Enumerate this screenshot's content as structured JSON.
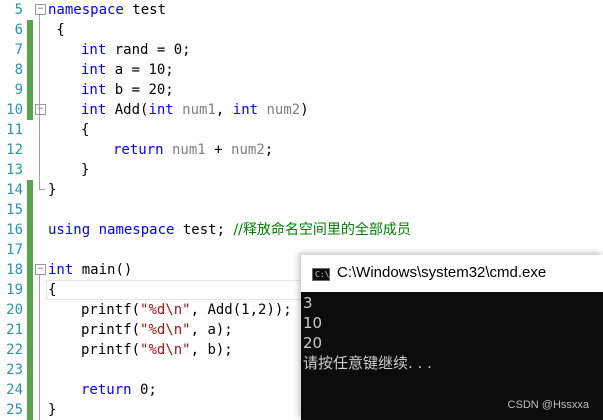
{
  "editor": {
    "lines": [
      {
        "n": "5"
      },
      {
        "n": "6"
      },
      {
        "n": "7"
      },
      {
        "n": "8"
      },
      {
        "n": "9"
      },
      {
        "n": "10"
      },
      {
        "n": "11"
      },
      {
        "n": "12"
      },
      {
        "n": "13"
      },
      {
        "n": "14"
      },
      {
        "n": "15"
      },
      {
        "n": "16"
      },
      {
        "n": "17"
      },
      {
        "n": "18"
      },
      {
        "n": "19"
      },
      {
        "n": "20"
      },
      {
        "n": "21"
      },
      {
        "n": "22"
      },
      {
        "n": "23"
      },
      {
        "n": "24"
      },
      {
        "n": "25"
      }
    ],
    "code": {
      "l5_kw": "namespace",
      "l5_name": " test",
      "l6": " {",
      "l7_kw": "int",
      "l7_rest": " rand = 0;",
      "l8_kw": "int",
      "l8_rest": " a = 10;",
      "l9_kw": "int",
      "l9_rest": " b = 20;",
      "l10_kw1": "int",
      "l10_a": " Add(",
      "l10_kw2": "int",
      "l10_p1": " num1",
      "l10_b": ", ",
      "l10_kw3": "int",
      "l10_p2": " num2",
      "l10_c": ")",
      "l11": "{",
      "l12_kw": "return",
      "l12_p1": " num1",
      "l12_a": " + ",
      "l12_p2": "num2",
      "l12_b": ";",
      "l13": "}",
      "l14": "}",
      "l16_kw1": "using",
      "l16_sp": " ",
      "l16_kw2": "namespace",
      "l16_rest": " test; ",
      "l16_comment": "//释放命名空间里的全部成员",
      "l18_kw": "int",
      "l18_rest": " main()",
      "l19": "{",
      "l20_a": "printf(",
      "l20_str": "\"%d\\n\"",
      "l20_b": ", Add(1,2));",
      "l21_a": "printf(",
      "l21_str": "\"%d\\n\"",
      "l21_b": ", a);",
      "l22_a": "printf(",
      "l22_str": "\"%d\\n\"",
      "l22_b": ", b);",
      "l24_kw": "return",
      "l24_rest": " 0;",
      "l25": "}"
    },
    "colors": {
      "keyword": "#0000ff",
      "param": "#808080",
      "string": "#a31515",
      "comment": "#008000",
      "line_number": "#2b91af",
      "change_bar": "#57a64a"
    }
  },
  "console": {
    "icon_text": "C:\\",
    "title": "C:\\Windows\\system32\\cmd.exe",
    "output": [
      "3",
      "10",
      "20",
      "请按任意键继续. . ."
    ]
  },
  "watermark": "CSDN @Hssxxa"
}
